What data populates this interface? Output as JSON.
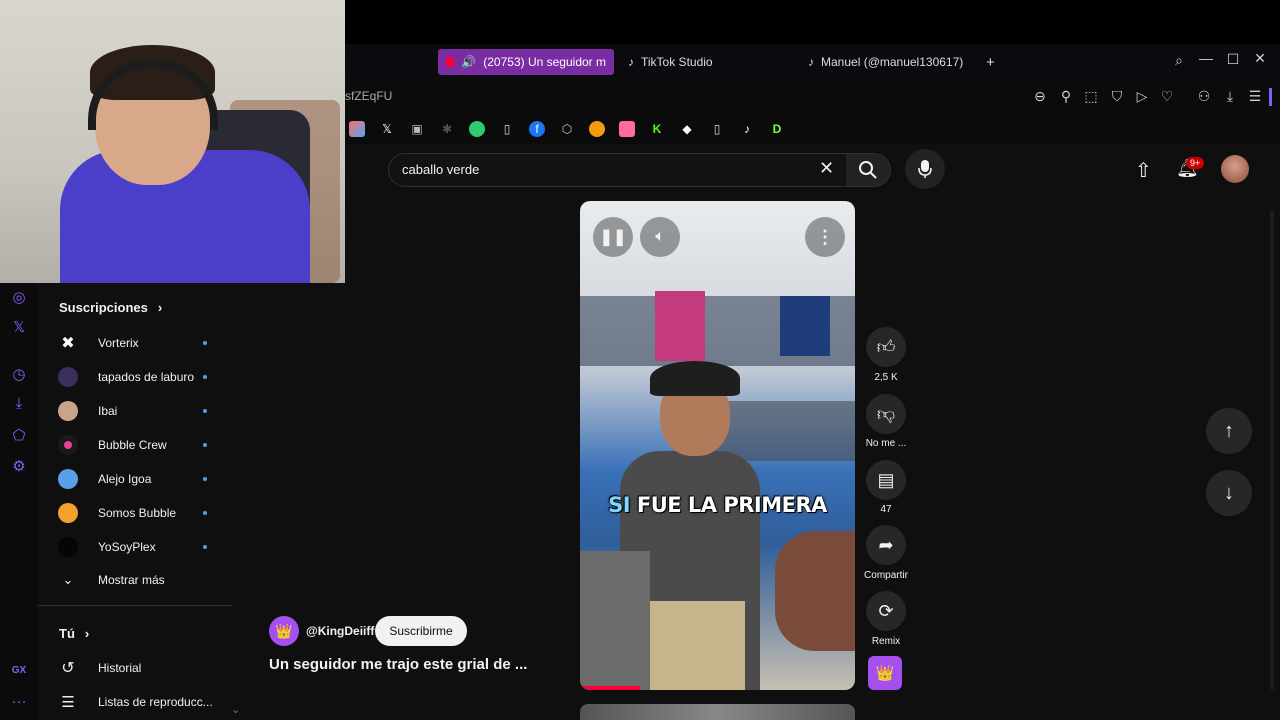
{
  "browser": {
    "tabs": [
      {
        "label": "(20753) Un seguidor m",
        "active": true
      },
      {
        "label": "TikTok Studio",
        "active": false
      },
      {
        "label": "Manuel (@manuel130617)",
        "active": false
      }
    ],
    "new_tab": "+",
    "url_fragment": "sfZEqFU",
    "accent": "#7a2ca3"
  },
  "header": {
    "search_value": "caballo verde",
    "notification_count": "9+"
  },
  "sidebar": {
    "subscriptions_title": "Suscripciones",
    "subscriptions_chevron": "›",
    "channels": [
      {
        "name": "Vorterix"
      },
      {
        "name": "tapados de laburo"
      },
      {
        "name": "Ibai"
      },
      {
        "name": "Bubble Crew"
      },
      {
        "name": "Alejo Igoa"
      },
      {
        "name": "Somos Bubble"
      },
      {
        "name": "YoSoyPlex"
      }
    ],
    "show_more": "Mostrar más",
    "you_title": "Tú",
    "you_chevron": "›",
    "history": "Historial",
    "playlists": "Listas de reproducc..."
  },
  "short": {
    "caption": "SI FUE LA PRIMERA",
    "caption_highlight": "SI",
    "channel": "@KingDeiiff",
    "subscribe_label": "Suscribirme",
    "title": "Un seguidor me trajo este grial de ...",
    "likes": "2,5 K",
    "dislike_label": "No me ...",
    "comments": "47",
    "share_label": "Compartir",
    "remix_label": "Remix"
  },
  "left_rail": {
    "bottom_label": "GX",
    "more": "···"
  }
}
